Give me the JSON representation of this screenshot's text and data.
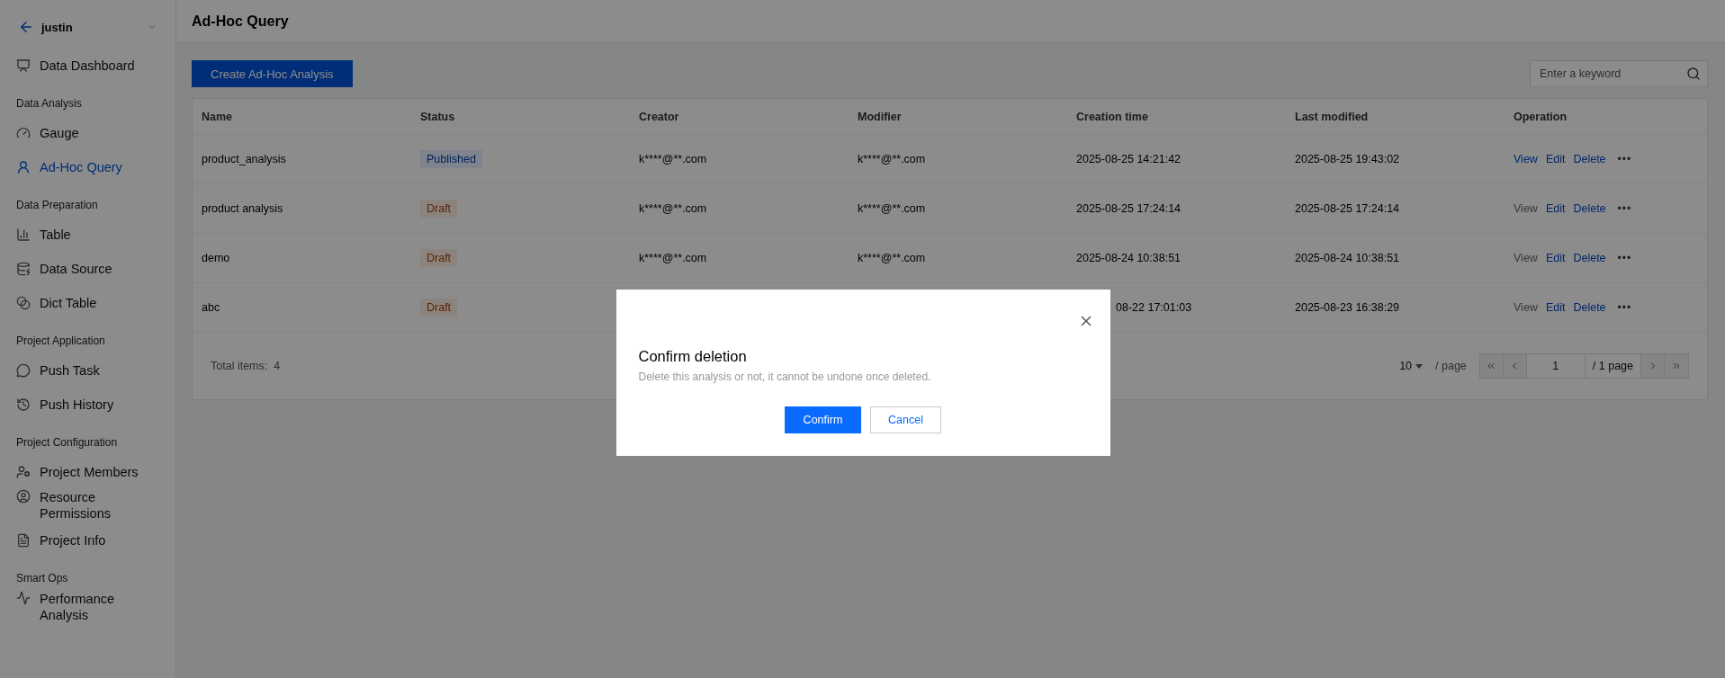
{
  "sidebar": {
    "project": "justin",
    "items": [
      {
        "kind": "item",
        "label": "Data Dashboard",
        "selected": false
      },
      {
        "kind": "group",
        "label": "Data Analysis"
      },
      {
        "kind": "item",
        "label": "Gauge",
        "selected": false
      },
      {
        "kind": "item",
        "label": "Ad-Hoc Query",
        "selected": true
      },
      {
        "kind": "group",
        "label": "Data Preparation"
      },
      {
        "kind": "item",
        "label": "Table",
        "selected": false
      },
      {
        "kind": "item",
        "label": "Data Source",
        "selected": false
      },
      {
        "kind": "item",
        "label": "Dict Table",
        "selected": false
      },
      {
        "kind": "group",
        "label": "Project Application"
      },
      {
        "kind": "item",
        "label": "Push Task",
        "selected": false
      },
      {
        "kind": "item",
        "label": "Push History",
        "selected": false
      },
      {
        "kind": "group",
        "label": "Project Configuration"
      },
      {
        "kind": "item",
        "label": "Project Members",
        "selected": false
      },
      {
        "kind": "item",
        "label": "Resource Permissions",
        "selected": false
      },
      {
        "kind": "item",
        "label": "Project Info",
        "selected": false
      },
      {
        "kind": "group",
        "label": "Smart Ops"
      },
      {
        "kind": "item",
        "label": "Performance Analysis",
        "selected": false
      }
    ]
  },
  "page_title": "Ad-Hoc Query",
  "create_button": "Create Ad-Hoc Analysis",
  "search": {
    "placeholder": "Enter a keyword"
  },
  "table": {
    "columns": [
      "Name",
      "Status",
      "Creator",
      "Modifier",
      "Creation time",
      "Last modified",
      "Operation"
    ],
    "rows": [
      {
        "name": "product_analysis",
        "status": {
          "label": "Published",
          "kind": "published"
        },
        "creator": "k****@**.com",
        "modifier": "k****@**.com",
        "creation_time": "2025-08-25 14:21:42",
        "last_modified": "2025-08-25 19:43:02",
        "covered": false,
        "operations": [
          {
            "label": "View",
            "disabled": false
          },
          {
            "label": "Edit",
            "disabled": false
          },
          {
            "label": "Delete",
            "disabled": false
          }
        ],
        "more": "•••"
      },
      {
        "name": "product analysis",
        "status": {
          "label": "Draft",
          "kind": "draft"
        },
        "creator": "k****@**.com",
        "modifier": "k****@**.com",
        "creation_time": "2025-08-25 17:24:14",
        "last_modified": "2025-08-25 17:24:14",
        "covered": false,
        "operations": [
          {
            "label": "View",
            "disabled": true
          },
          {
            "label": "Edit",
            "disabled": false
          },
          {
            "label": "Delete",
            "disabled": false
          }
        ],
        "more": "•••"
      },
      {
        "name": "demo",
        "status": {
          "label": "Draft",
          "kind": "draft"
        },
        "creator": "k****@**.com",
        "modifier": "k****@**.com",
        "creation_time": "2025-08-24 10:38:51",
        "last_modified": "2025-08-24 10:38:51",
        "covered": false,
        "operations": [
          {
            "label": "View",
            "disabled": true
          },
          {
            "label": "Edit",
            "disabled": false
          },
          {
            "label": "Delete",
            "disabled": false
          }
        ],
        "more": "•••"
      },
      {
        "name": "abc",
        "status": {
          "label": "Draft",
          "kind": "draft"
        },
        "creation_time": "08-22 17:01:03",
        "last_modified": "2025-08-23 16:38:29",
        "covered": true,
        "operations": [
          {
            "label": "View",
            "disabled": true
          },
          {
            "label": "Edit",
            "disabled": false
          },
          {
            "label": "Delete",
            "disabled": false
          }
        ],
        "more": "•••"
      }
    ],
    "total_label": "Total items:",
    "total": "4"
  },
  "pagination": {
    "page_size": "10",
    "page_size_suffix": "/ page",
    "page": "1",
    "total_pages": "/ 1 page"
  },
  "dialog": {
    "title": "Confirm deletion",
    "message": "Delete this analysis or not, it cannot be undone once deleted.",
    "confirm": "Confirm",
    "cancel": "Cancel"
  }
}
